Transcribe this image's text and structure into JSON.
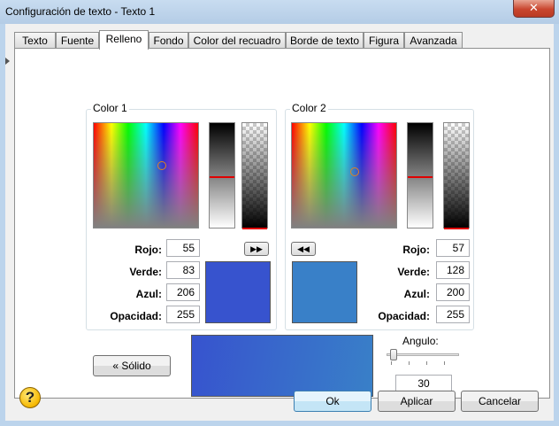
{
  "window": {
    "title": "Configuración de texto - Texto 1",
    "close_glyph": "✕"
  },
  "tabs": [
    {
      "label": "Texto"
    },
    {
      "label": "Fuente"
    },
    {
      "label": "Relleno",
      "active": true
    },
    {
      "label": "Fondo"
    },
    {
      "label": "Color del recuadro"
    },
    {
      "label": "Borde de texto"
    },
    {
      "label": "Figura"
    },
    {
      "label": "Avanzada"
    }
  ],
  "color1": {
    "label": "Color 1",
    "fields": {
      "rojo_label": "Rojo:",
      "rojo": "55",
      "verde_label": "Verde:",
      "verde": "83",
      "azul_label": "Azul:",
      "azul": "206",
      "opacidad_label": "Opacidad:",
      "opacidad": "255"
    },
    "swatch_color": "#3753ce",
    "copy_button_glyph": "▶▶"
  },
  "color2": {
    "label": "Color 2",
    "fields": {
      "rojo_label": "Rojo:",
      "rojo": "57",
      "verde_label": "Verde:",
      "verde": "128",
      "azul_label": "Azul:",
      "azul": "200",
      "opacidad_label": "Opacidad:",
      "opacidad": "255"
    },
    "swatch_color": "#3980c8",
    "copy_button_glyph": "◀◀"
  },
  "solid_button": "« Sólido",
  "preview_colors": [
    "#3753ce",
    "#3980c8"
  ],
  "angle": {
    "label": "Angulo:",
    "value": "30"
  },
  "footer": {
    "help_glyph": "?",
    "ok": "Ok",
    "apply": "Aplicar",
    "cancel": "Cancelar"
  }
}
